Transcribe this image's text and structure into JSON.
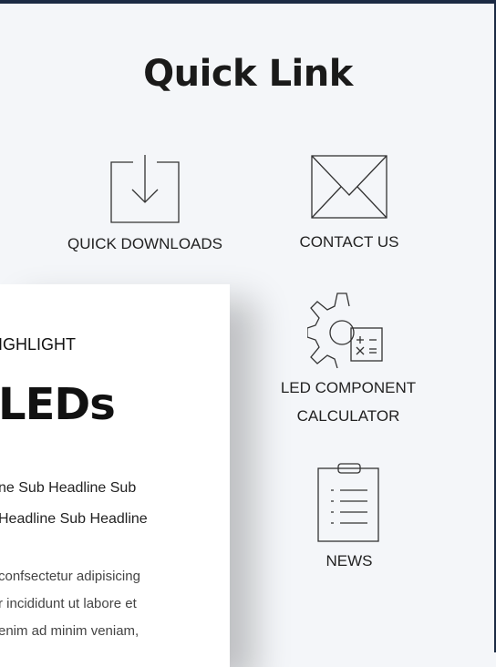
{
  "section": {
    "title": "Quick Link"
  },
  "links": {
    "downloads": {
      "label": "QUICK DOWNLOADS",
      "icon": "download-icon"
    },
    "contact": {
      "label": "CONTACT US",
      "icon": "envelope-icon"
    },
    "calculator": {
      "line1": "LED COMPONENT",
      "line2": "CALCULATOR",
      "icon": "gear-calculator-icon"
    },
    "news": {
      "label": "NEWS",
      "icon": "clipboard-list-icon"
    }
  },
  "card": {
    "eyebrow": "IGHLIGHT",
    "title": "LEDs",
    "subtitle_line1": "ne Sub Headline Sub",
    "subtitle_line2": "Headline Sub Headline",
    "body_line1": "confsectetur adipisicing",
    "body_line2": "r incididunt ut labore et",
    "body_line3": "enim ad minim veniam,"
  },
  "colors": {
    "frame": "#1c2b44",
    "background": "#f4f6f9",
    "card": "#ffffff"
  }
}
